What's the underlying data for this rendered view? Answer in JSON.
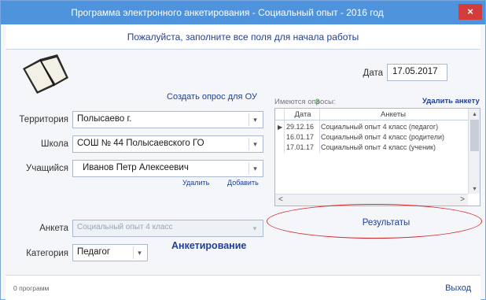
{
  "window": {
    "title": "Программа электронного анкетирования - Социальный опыт - 2016 год",
    "close_symbol": "×",
    "header_message": "Пожалуйста, заполните все поля для начала работы"
  },
  "date": {
    "label": "Дата",
    "value": "17.05.2017"
  },
  "create_survey_link": "Создать опрос для ОУ",
  "form": {
    "territory_label": "Территория",
    "territory_value": "Полысаево г.",
    "school_label": "Школа",
    "school_value": "СОШ № 44 Полысаевского ГО",
    "student_label": "Учащийся",
    "student_value": "Иванов Петр Алексеевич",
    "delete_label": "Удалить",
    "add_label": "Добавить",
    "survey_label": "Анкета",
    "survey_value": "Социальный опыт 4 класс",
    "category_label": "Категория",
    "category_value": "Педагог"
  },
  "surveys": {
    "label": "Имеются опросы:",
    "count": "3",
    "delete_survey_link": "Удалить анкету",
    "columns": {
      "date": "Дата",
      "survey": "Анкеты"
    },
    "rows": [
      {
        "pointer": "▶",
        "date": "29.12.16",
        "survey": "Социальный опыт 4 класс (педагог)"
      },
      {
        "pointer": "",
        "date": "16.01.17",
        "survey": "Социальный опыт 4 класс (родители)"
      },
      {
        "pointer": "",
        "date": "17.01.17",
        "survey": "Социальный опыт 4 класс (ученик)"
      }
    ]
  },
  "results_link": "Результаты",
  "survey_button": "Анкетирование",
  "footer": {
    "left": "0 программ",
    "right": "Выход"
  },
  "icons": {
    "arrow_down": "▾",
    "arrow_up": "▴",
    "arrow_left": "<",
    "arrow_right": ">"
  },
  "colors": {
    "titlebar": "#4f93dc",
    "link": "#1f3f99",
    "highlight": "#d42a2a",
    "close": "#d43c3c"
  }
}
